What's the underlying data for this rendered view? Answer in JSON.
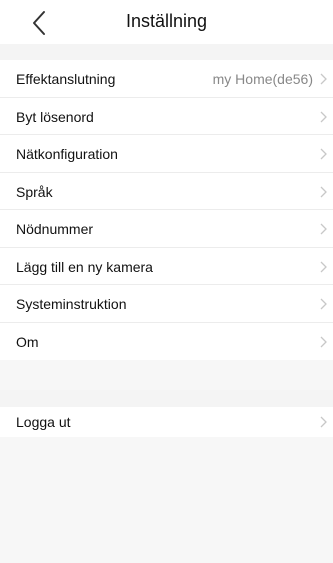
{
  "header": {
    "title": "Inställning",
    "back_icon": "chevron-left-icon"
  },
  "settings": {
    "items": [
      {
        "label": "Effektanslutning",
        "value": "my Home(de56)"
      },
      {
        "label": "Byt lösenord"
      },
      {
        "label": "Nätkonfiguration"
      },
      {
        "label": "Språk"
      },
      {
        "label": "Nödnummer"
      },
      {
        "label": "Lägg till en ny kamera"
      },
      {
        "label": "Systeminstruktion"
      },
      {
        "label": "Om"
      }
    ]
  },
  "logout": {
    "label": "Logga ut"
  }
}
